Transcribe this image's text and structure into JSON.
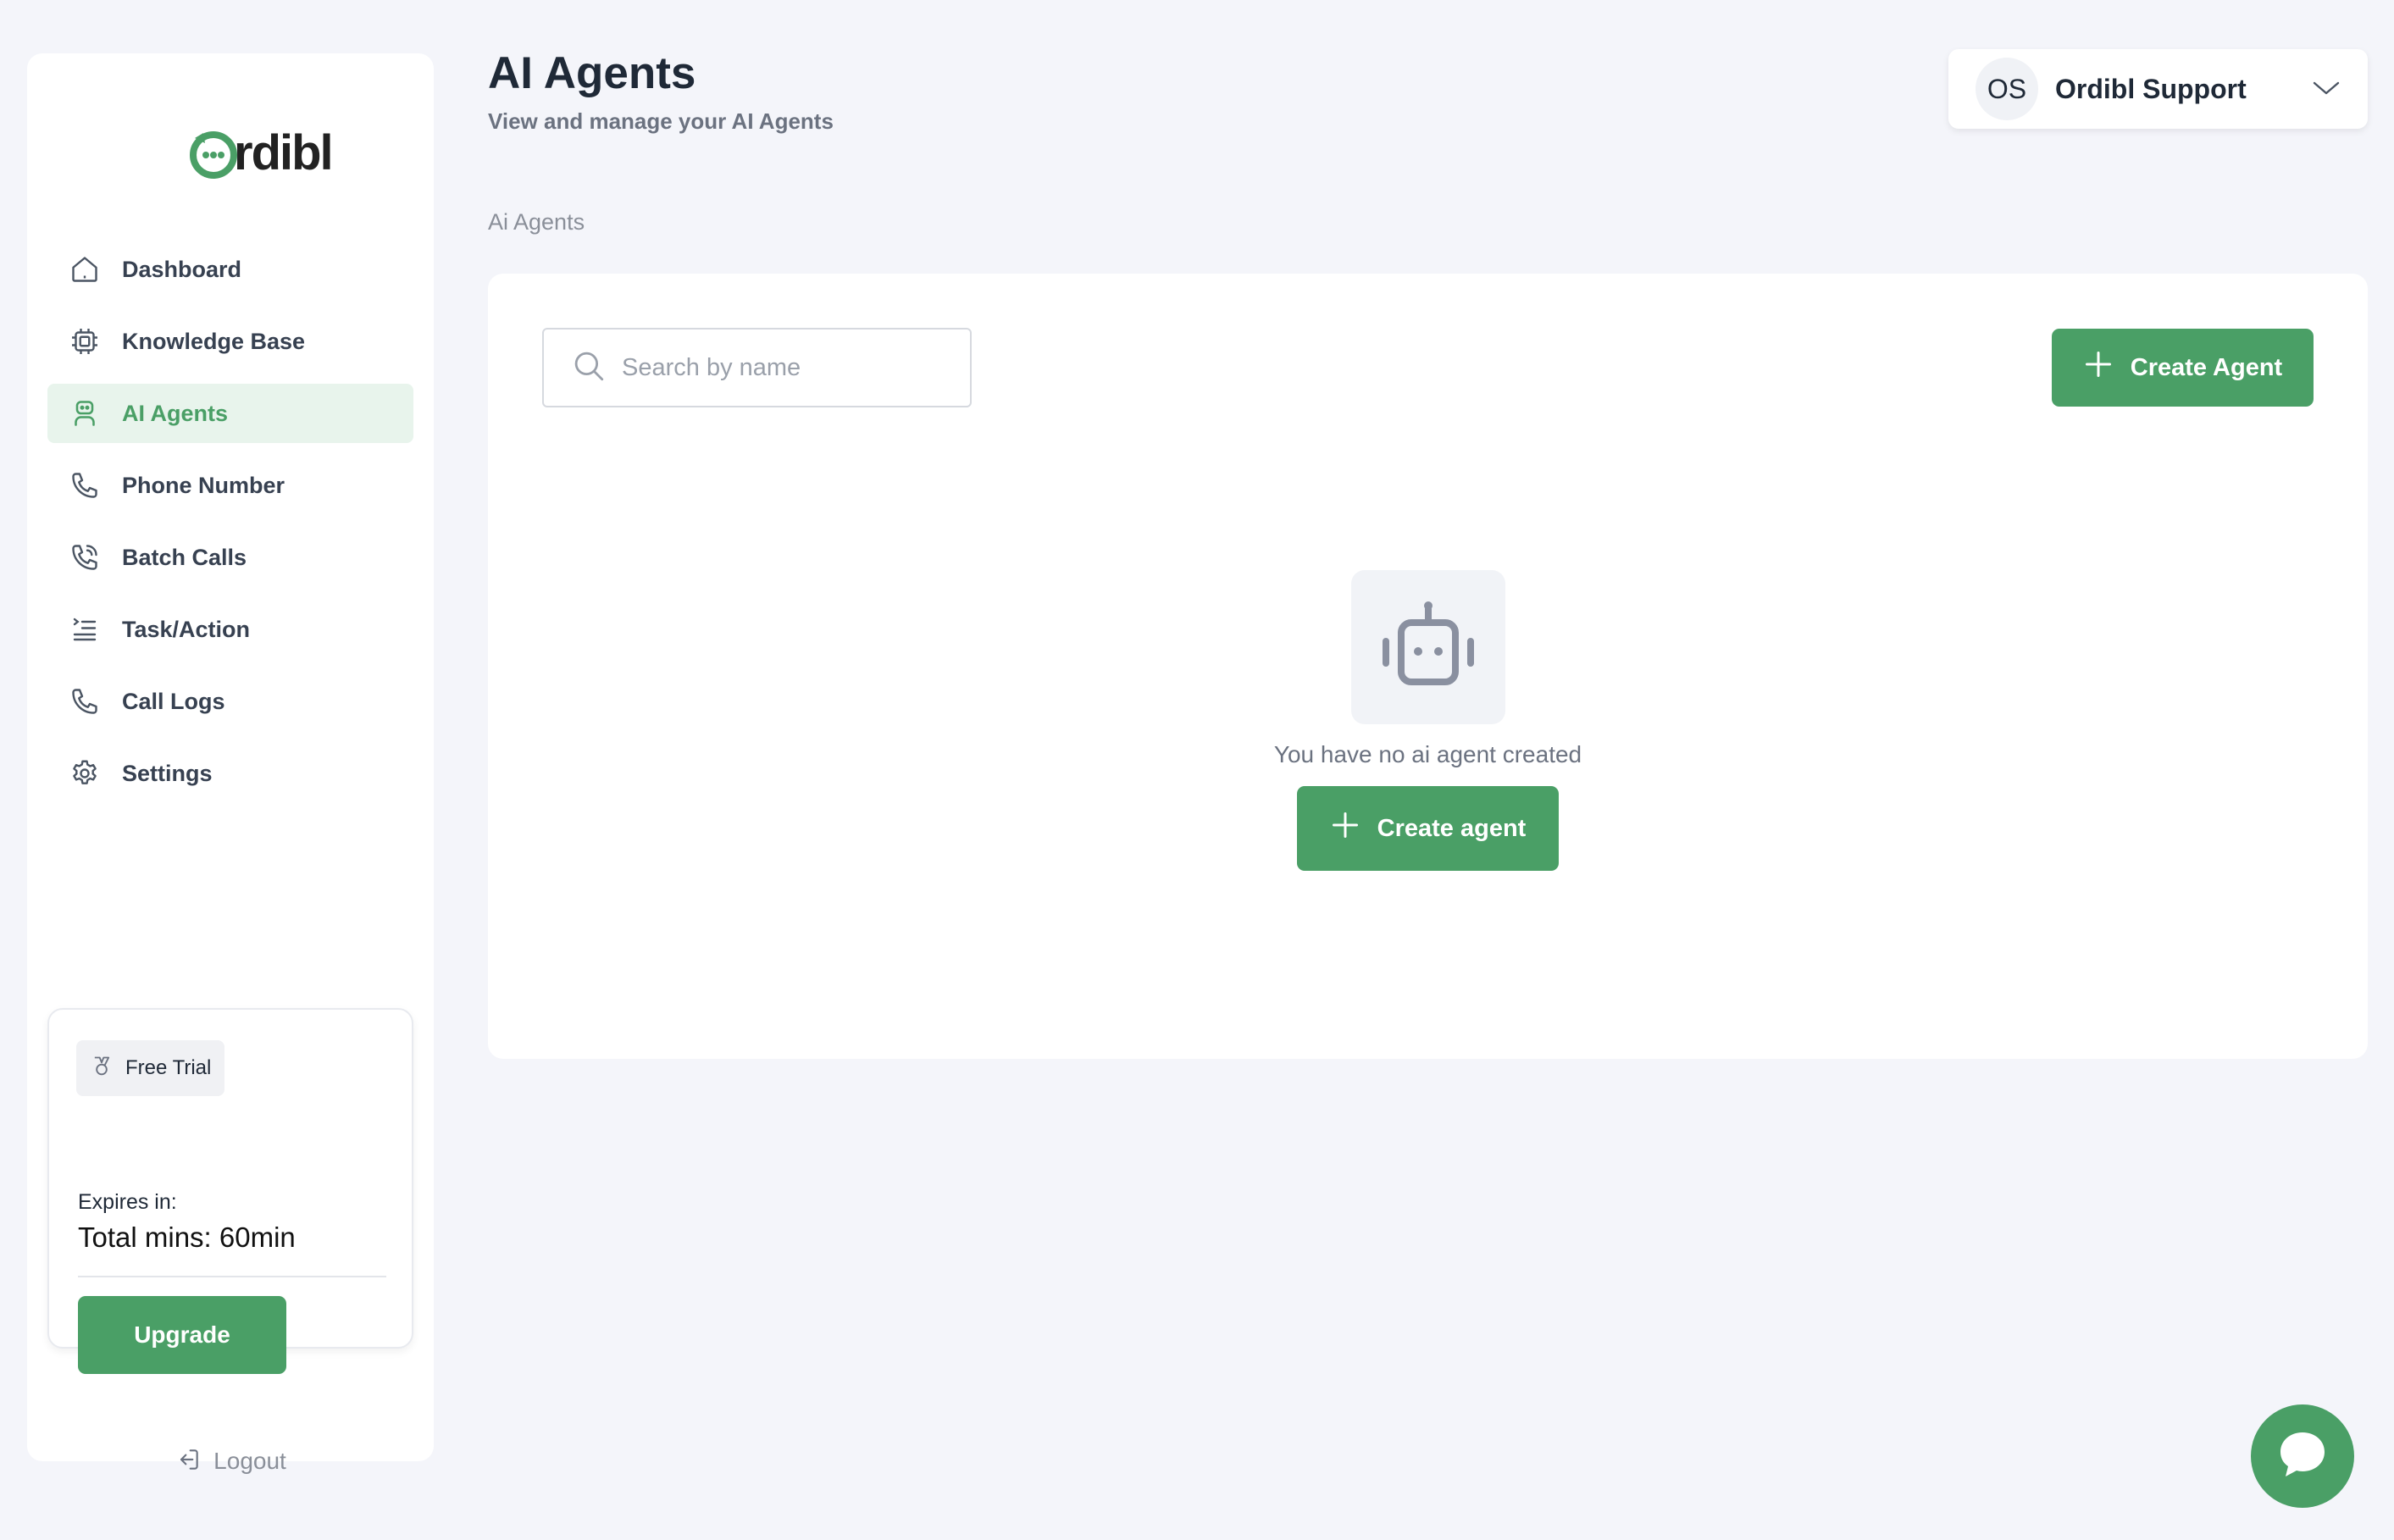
{
  "brand": {
    "logo_text": "rdibl",
    "accent": "#4a9f66"
  },
  "sidebar": {
    "items": [
      {
        "label": "Dashboard",
        "icon": "home-icon"
      },
      {
        "label": "Knowledge Base",
        "icon": "chip-icon"
      },
      {
        "label": "AI Agents",
        "icon": "agent-icon",
        "active": true
      },
      {
        "label": "Phone Number",
        "icon": "phone-icon"
      },
      {
        "label": "Batch Calls",
        "icon": "phone-calling-icon"
      },
      {
        "label": "Task/Action",
        "icon": "task-list-icon"
      },
      {
        "label": "Call Logs",
        "icon": "phone-icon"
      },
      {
        "label": "Settings",
        "icon": "gear-icon"
      }
    ],
    "trial": {
      "badge": "Free Trial",
      "expires_label": "Expires in:",
      "total_mins": "Total mins: 60min",
      "upgrade_label": "Upgrade"
    },
    "logout_label": "Logout"
  },
  "header": {
    "title": "AI Agents",
    "subtitle": "View and manage your AI Agents",
    "user": {
      "initials": "OS",
      "name": "Ordibl Support"
    }
  },
  "breadcrumb": "Ai Agents",
  "main": {
    "search_placeholder": "Search by name",
    "search_value": "",
    "create_top_label": "Create Agent",
    "empty_text": "You have no ai agent created",
    "create_center_label": "Create agent"
  }
}
